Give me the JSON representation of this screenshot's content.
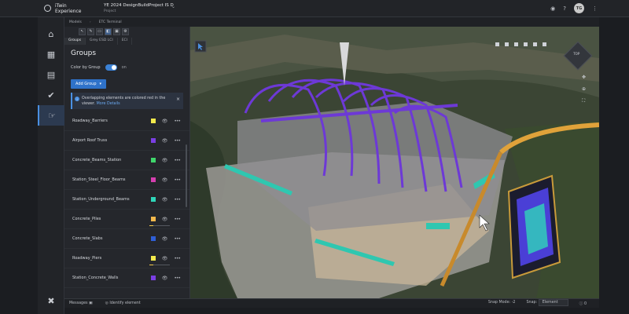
{
  "app": {
    "title": "iTwin Experience",
    "project_name": "YE 2024 DesignBuildProject IS D",
    "project_type": "Project",
    "user_initials": "TG"
  },
  "breadcrumb": {
    "root": "Models",
    "current": "ETC Terminal"
  },
  "panel": {
    "tabs": [
      "Groups",
      "Grey ESD LCI",
      "ECI"
    ],
    "title": "Groups",
    "color_by_group_label": "Color by Group",
    "color_by_group_value": "on",
    "add_group_label": "Add Group",
    "alert_text": "Overlapping elements are colored red in the viewer.",
    "alert_link": "More Details",
    "groups": [
      {
        "name": "Roadway_Barriers",
        "color": "#f2e94c"
      },
      {
        "name": "Airport Roof Truss",
        "color": "#7b3fe4"
      },
      {
        "name": "Concrete_Beams_Station",
        "color": "#3fd66b"
      },
      {
        "name": "Station_Steel_Floor_Beams",
        "color": "#d63fb0"
      },
      {
        "name": "Station_Underground_Beams",
        "color": "#2fd6b9"
      },
      {
        "name": "Concrete_Piles",
        "color": "#f2b84c",
        "progress": 0.2
      },
      {
        "name": "Concrete_Slabs",
        "color": "#2f5fd6"
      },
      {
        "name": "Roadway_Piers",
        "color": "#f2e94c",
        "progress": 0.2
      },
      {
        "name": "Station_Concrete_Walls",
        "color": "#7b3fe4"
      }
    ]
  },
  "status": {
    "messages_label": "Messages",
    "identify_label": "Identify element",
    "snap_mode_label": "Snap Mode",
    "snap_mode_value": "-2",
    "snap_label": "Snap",
    "snap_value": "Element",
    "count": "0"
  },
  "colors": {
    "accent": "#3b82d6",
    "truss": "#7b3fe4",
    "teal": "#2fd6b9",
    "orange": "#f2b84c"
  }
}
